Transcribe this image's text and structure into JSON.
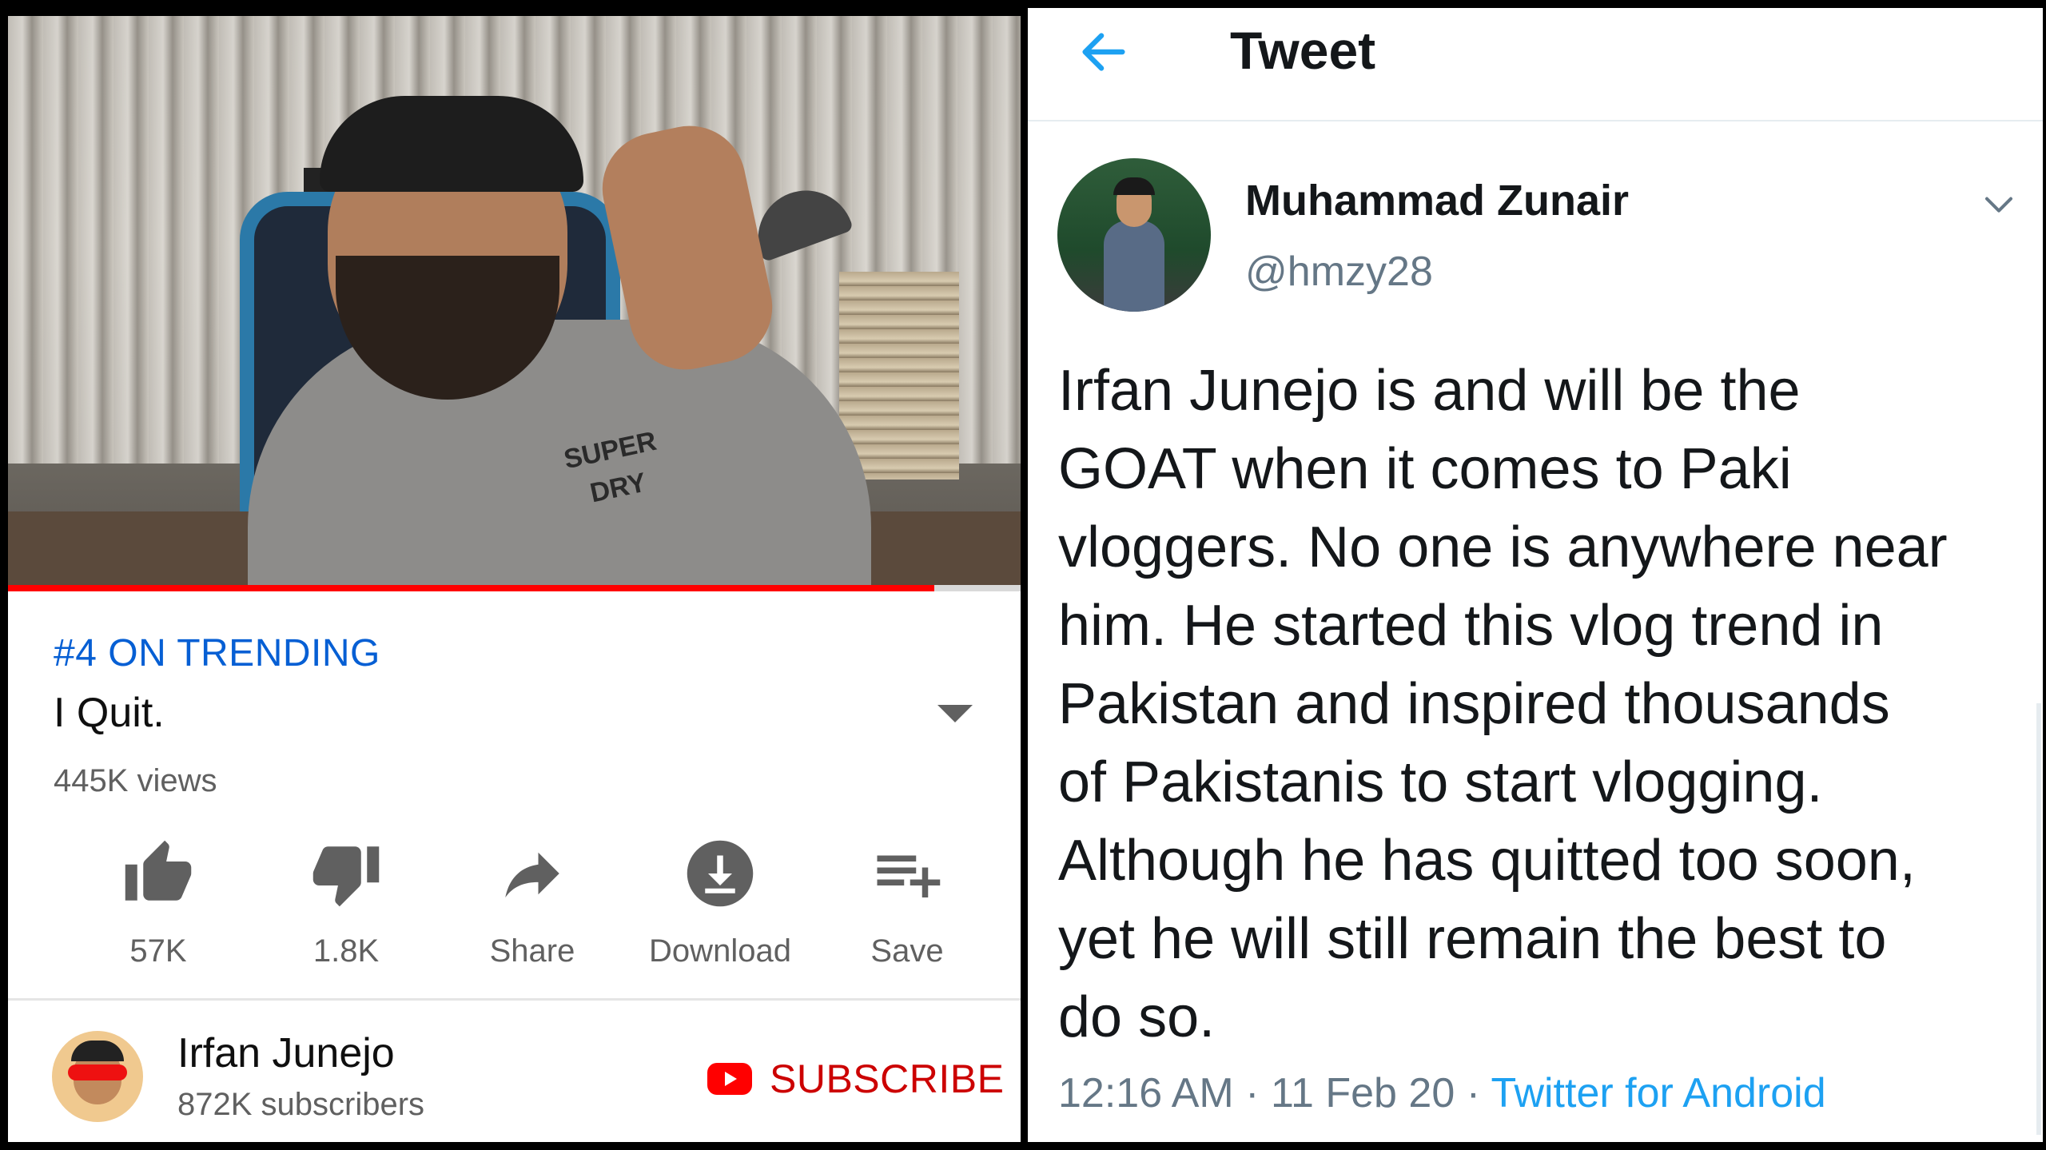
{
  "youtube": {
    "video": {
      "progress_fraction": 0.915,
      "shirt_text": [
        "SUPER",
        "DRY"
      ]
    },
    "trending_label": "#4 ON TRENDING",
    "title": "I Quit.",
    "views": "445K views",
    "actions": [
      {
        "icon": "thumbs-up-icon",
        "label": "57K"
      },
      {
        "icon": "thumbs-down-icon",
        "label": "1.8K"
      },
      {
        "icon": "share-icon",
        "label": "Share"
      },
      {
        "icon": "download-icon",
        "label": "Download"
      },
      {
        "icon": "playlist-add-icon",
        "label": "Save"
      }
    ],
    "channel": {
      "name": "Irfan Junejo",
      "subscribers": "872K subscribers"
    },
    "subscribe_label": "SUBSCRIBE",
    "colors": {
      "accent_link": "#065fd4",
      "subscribe": "#cc0000",
      "progress": "#ff0000"
    }
  },
  "twitter": {
    "header": "Tweet",
    "author": {
      "name": "Muhammad Zunair",
      "handle": "@hmzy28"
    },
    "text": "Irfan Junejo is and will be the\nGOAT when it comes to Paki\nvloggers. No one is anywhere near\nhim. He started this vlog trend in\nPakistan and inspired thousands\nof Pakistanis to start vlogging.\nAlthough he has quitted too soon,\nyet he will still remain the best to\ndo so.",
    "time": "12:16 AM",
    "date": "11 Feb 20",
    "source": "Twitter for Android",
    "separator": " · ",
    "colors": {
      "accent": "#1da1f2",
      "muted": "#657786"
    }
  }
}
